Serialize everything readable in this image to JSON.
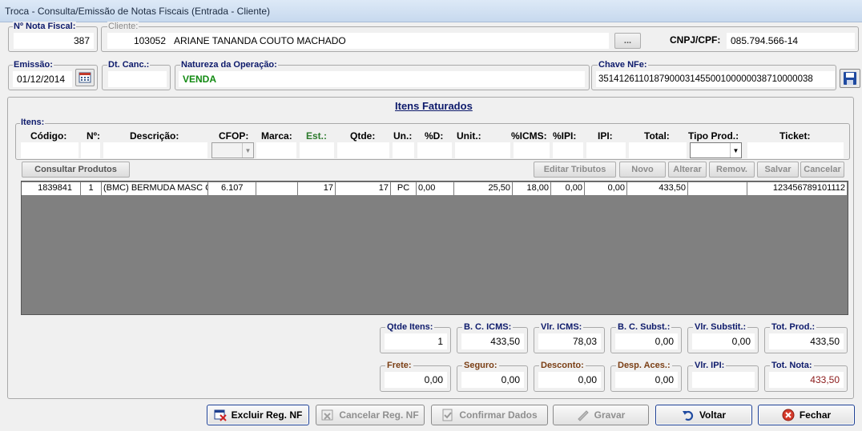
{
  "window": {
    "title": "Troca - Consulta/Emissão de Notas Fiscais (Entrada - Cliente)"
  },
  "header": {
    "nf_label": "Nº Nota Fiscal:",
    "nf_value": "387",
    "cliente_label": "Cliente:",
    "cliente_code": "103052",
    "cliente_name": "ARIANE TANANDA COUTO MACHADO",
    "cliente_lookup": "...",
    "cnpj_label": "CNPJ/CPF:",
    "cnpj_value": "085.794.566-14",
    "emissao_label": "Emissão:",
    "emissao_value": "01/12/2014",
    "dtcanc_label": "Dt. Canc.:",
    "dtcanc_value": "",
    "natureza_label": "Natureza da Operação:",
    "natureza_value": "VENDA",
    "chave_label": "Chave NFe:",
    "chave_value": "35141261101879000314550010000003871000003​8"
  },
  "items": {
    "title": "Itens Faturados",
    "group_label": "Itens:",
    "columns": {
      "codigo": "Código:",
      "num": "Nº:",
      "descricao": "Descrição:",
      "cfop": "CFOP:",
      "marca": "Marca:",
      "est": "Est.:",
      "qtde": "Qtde:",
      "un": "Un.:",
      "pd": "%D:",
      "unit": "Unit.:",
      "icms": "%ICMS:",
      "ipi_pct": "%IPI:",
      "ipi": "IPI:",
      "total": "Total:",
      "tipo": "Tipo Prod.:",
      "ticket": "Ticket:"
    },
    "buttons": {
      "consultar": "Consultar Produtos",
      "editar": "Editar Tributos",
      "novo": "Novo",
      "alterar": "Alterar",
      "remover": "Remov.",
      "salvar": "Salvar",
      "cancelar": "Cancelar"
    },
    "rows": [
      {
        "codigo": "1839841",
        "num": "1",
        "descricao": "(BMC) BERMUDA MASC C",
        "cfop": "6.107",
        "marca": "",
        "est": "17",
        "qtde": "17",
        "un": "PC",
        "pd": "0,00",
        "unit": "25,50",
        "icms": "18,00",
        "ipi_pct": "0,00",
        "ipi": "0,00",
        "total": "433,50",
        "tipo": "",
        "ticket": "123456789101112"
      }
    ]
  },
  "totals": {
    "qtde_itens_label": "Qtde Itens:",
    "qtde_itens": "1",
    "bc_icms_label": "B. C. ICMS:",
    "bc_icms": "433,50",
    "vlr_icms_label": "Vlr. ICMS:",
    "vlr_icms": "78,03",
    "bc_subst_label": "B. C. Subst.:",
    "bc_subst": "0,00",
    "vlr_subst_label": "Vlr. Substit.:",
    "vlr_subst": "0,00",
    "tot_prod_label": "Tot. Prod.:",
    "tot_prod": "433,50",
    "frete_label": "Frete:",
    "frete": "0,00",
    "seguro_label": "Seguro:",
    "seguro": "0,00",
    "desconto_label": "Desconto:",
    "desconto": "0,00",
    "desp_label": "Desp. Aces.:",
    "desp": "0,00",
    "vlr_ipi_label": "Vlr. IPI:",
    "vlr_ipi": "",
    "tot_nota_label": "Tot. Nota:",
    "tot_nota": "433,50"
  },
  "footer": {
    "excluir": "Excluir Reg. NF",
    "cancelar": "Cancelar Reg. NF",
    "confirmar": "Confirmar Dados",
    "gravar": "Gravar",
    "voltar": "Voltar",
    "fechar": "Fechar"
  },
  "colors": {
    "label_blue": "#0d1a6b",
    "green": "#128a12",
    "red_total": "#8b1a1a",
    "grid_bg": "#808080"
  }
}
